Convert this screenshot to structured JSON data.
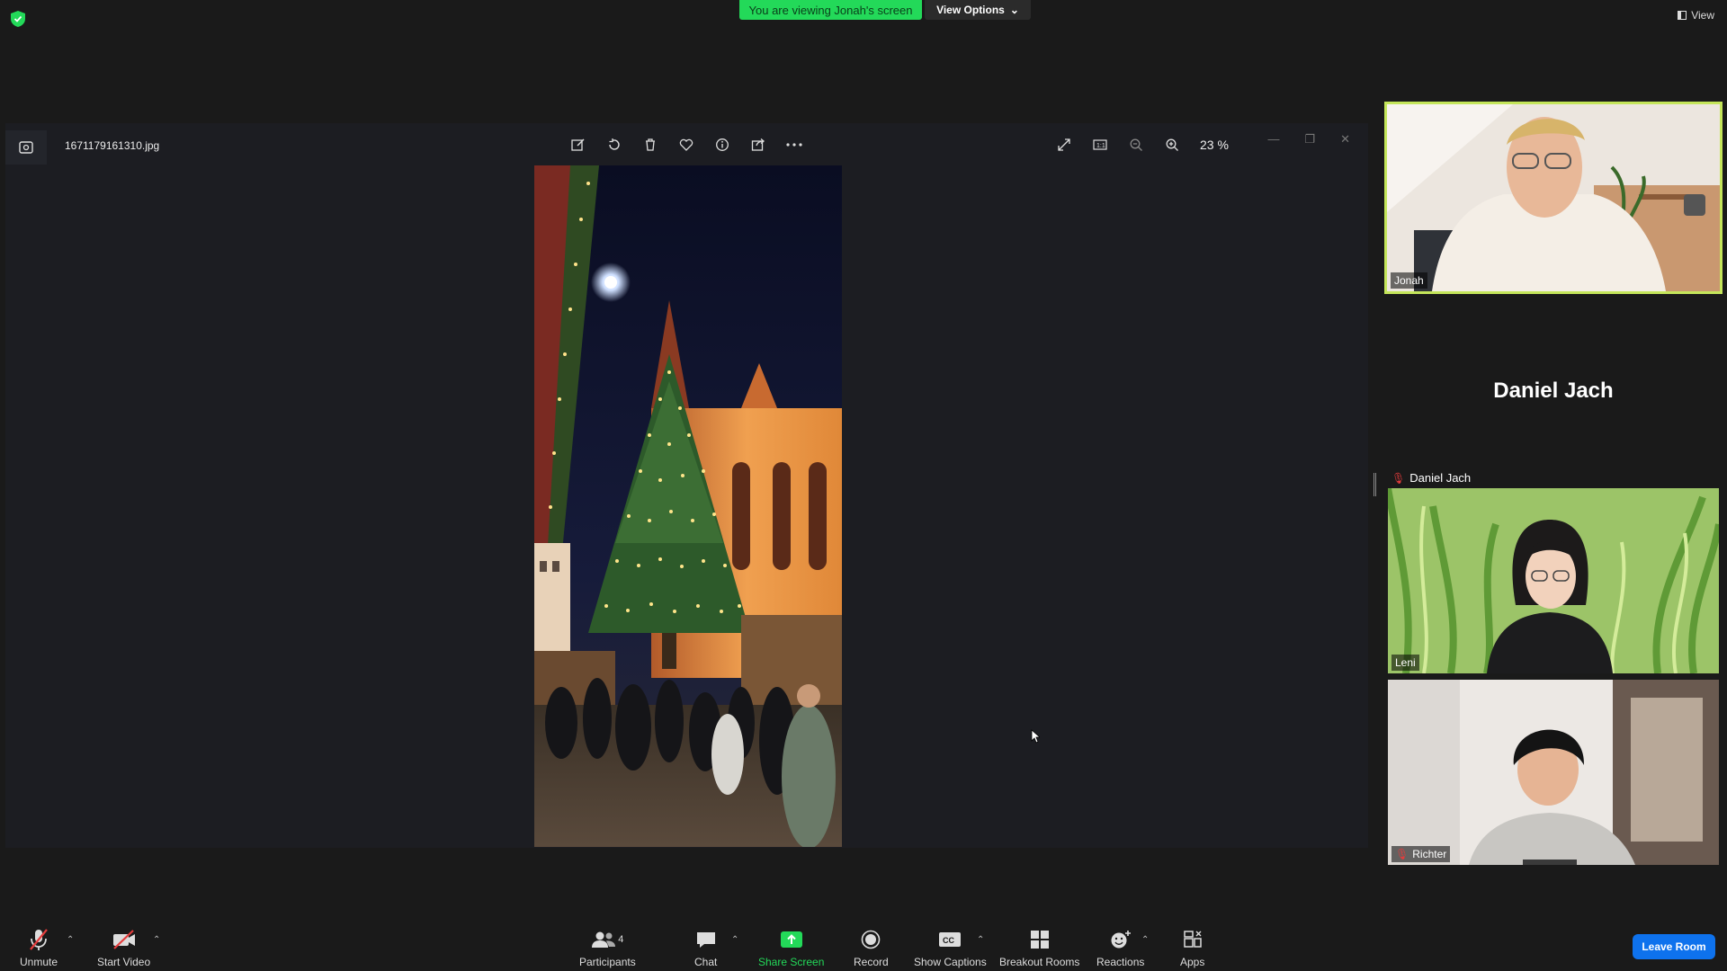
{
  "top_bar": {
    "viewing_banner": "You are viewing Jonah's screen",
    "view_options": "View Options",
    "view": "View"
  },
  "shared_window": {
    "filename": "1671179161310.jpg",
    "zoom": "23 %",
    "tool_icons": [
      "edit-image-icon",
      "rotate-icon",
      "delete-icon",
      "favorite-icon",
      "info-icon",
      "share-icon",
      "more-icon"
    ],
    "right_icons": [
      "fullscreen-icon",
      "actual-size-icon",
      "zoom-out-icon",
      "zoom-in-icon"
    ]
  },
  "participants": {
    "jonah": {
      "name": "Jonah"
    },
    "daniel": {
      "display_name": "Daniel Jach",
      "name": "Daniel Jach"
    },
    "leni": {
      "name": "Leni"
    },
    "richter": {
      "name": "Richter"
    }
  },
  "toolbar": {
    "unmute": "Unmute",
    "start_video": "Start Video",
    "participants": "Participants",
    "participants_count": "4",
    "chat": "Chat",
    "share_screen": "Share Screen",
    "record": "Record",
    "show_captions": "Show Captions",
    "breakout_rooms": "Breakout Rooms",
    "reactions": "Reactions",
    "apps": "Apps",
    "leave_room": "Leave Room"
  },
  "colors": {
    "banner_green": "#23d959",
    "active_speaker": "#c4e55a",
    "leave_blue": "#0e72ed",
    "mute_red": "#e43c3c"
  }
}
